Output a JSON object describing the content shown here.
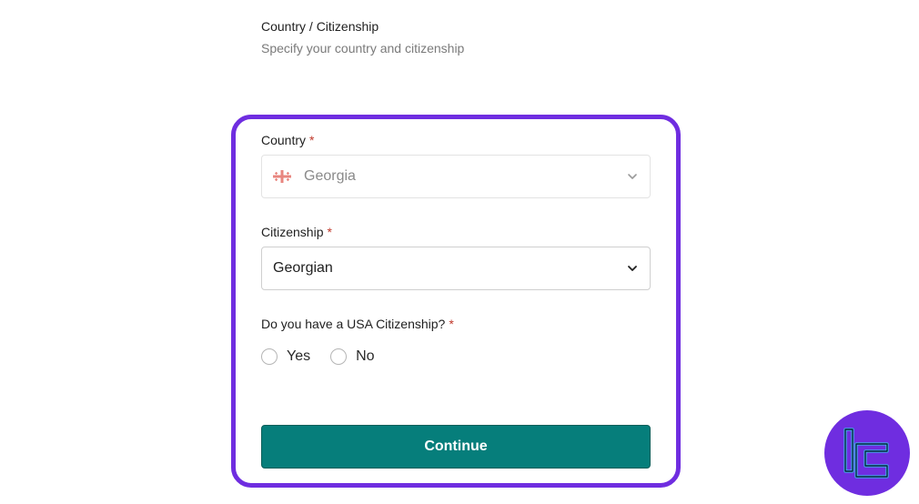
{
  "header": {
    "title": "Country / Citizenship",
    "subtitle": "Specify your country and citizenship"
  },
  "form": {
    "country": {
      "label": "Country",
      "required_mark": "*",
      "value": "Georgia",
      "flag_icon": "georgia-flag-icon",
      "disabled": true
    },
    "citizenship": {
      "label": "Citizenship",
      "required_mark": "*",
      "value": "Georgian"
    },
    "usa_citizenship": {
      "label": "Do you have a USA Citizenship?",
      "required_mark": "*",
      "options": [
        "Yes",
        "No"
      ]
    },
    "continue_label": "Continue"
  },
  "colors": {
    "panel_border": "#6f2de0",
    "button_bg": "#067e7b",
    "required": "#c0392b",
    "logo_bg": "#6f2de0",
    "logo_mark": "#35d6f2"
  }
}
